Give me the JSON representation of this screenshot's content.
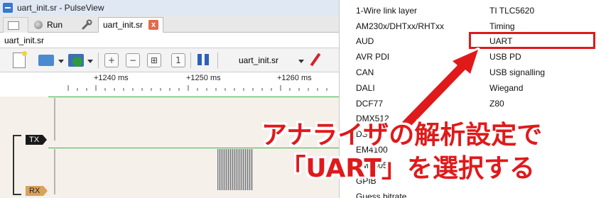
{
  "window": {
    "title": "uart_init.sr - PulseView"
  },
  "tabs": {
    "run_label": "Run",
    "file_tab_label": "uart_init.sr",
    "close_glyph": "x"
  },
  "session": {
    "label": "uart_init.sr"
  },
  "toolbar": {
    "zoom_in_glyph": "+",
    "zoom_out_glyph": "−",
    "zoom_fit_glyph": "⊞",
    "zoom_one_glyph": "1",
    "session_selector": "uart_init.sr"
  },
  "ruler": {
    "ticks": [
      "+1240 ms",
      "+1250 ms",
      "+1260 ms"
    ]
  },
  "channels": {
    "tx": "TX",
    "rx": "RX"
  },
  "decoders": {
    "col1": [
      "1-Wire link layer",
      "AM230x/DHTxx/RHTxx",
      "AUD",
      "AVR PDI",
      "CAN",
      "DALI",
      "DCF77",
      "DMX512",
      "DSI",
      "EM4100",
      "EM4305",
      "GPIB",
      "Guess bitrate"
    ],
    "col2": [
      "TI TLC5620",
      "Timing",
      "UART",
      "USB PD",
      "USB signalling",
      "Wiegand",
      "Z80"
    ],
    "selected": "UART"
  },
  "annotation": {
    "line1": "アナライザの解析設定で",
    "line2": "「UART」を選択する",
    "color": "#e0191a"
  }
}
